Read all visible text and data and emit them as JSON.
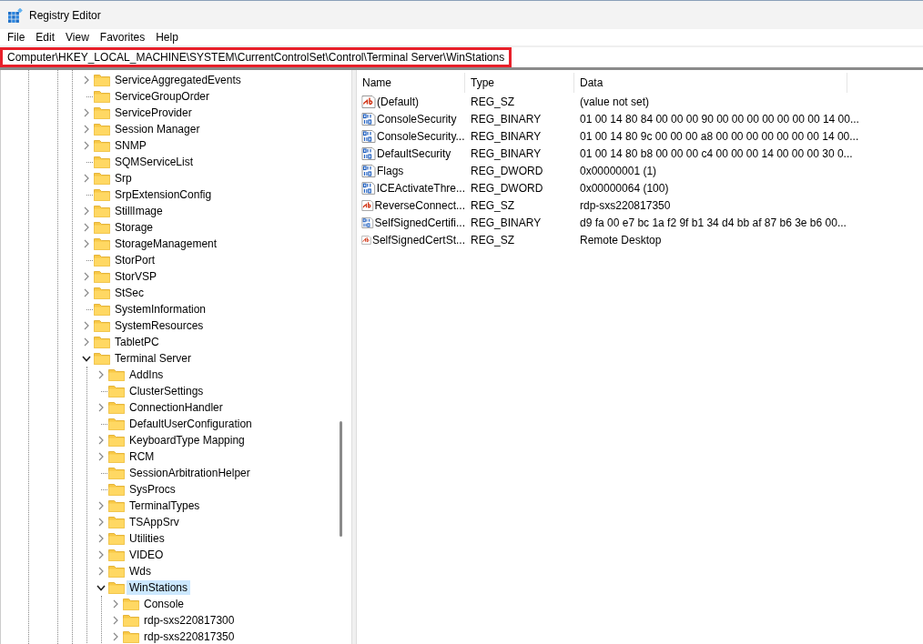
{
  "window": {
    "title": "Registry Editor"
  },
  "menu": [
    "File",
    "Edit",
    "View",
    "Favorites",
    "Help"
  ],
  "address": {
    "path": "Computer\\HKEY_LOCAL_MACHINE\\SYSTEM\\CurrentControlSet\\Control\\Terminal Server\\WinStations",
    "highlighted": true
  },
  "tree": [
    {
      "label": "ServiceAggregatedEvents",
      "expandable": true,
      "expanded": false,
      "selected": false
    },
    {
      "label": "ServiceGroupOrder",
      "expandable": false,
      "selected": false
    },
    {
      "label": "ServiceProvider",
      "expandable": true,
      "expanded": false,
      "selected": false
    },
    {
      "label": "Session Manager",
      "expandable": true,
      "expanded": false,
      "selected": false
    },
    {
      "label": "SNMP",
      "expandable": true,
      "expanded": false,
      "selected": false
    },
    {
      "label": "SQMServiceList",
      "expandable": false,
      "selected": false
    },
    {
      "label": "Srp",
      "expandable": true,
      "expanded": false,
      "selected": false
    },
    {
      "label": "SrpExtensionConfig",
      "expandable": false,
      "selected": false
    },
    {
      "label": "StillImage",
      "expandable": true,
      "expanded": false,
      "selected": false
    },
    {
      "label": "Storage",
      "expandable": true,
      "expanded": false,
      "selected": false
    },
    {
      "label": "StorageManagement",
      "expandable": true,
      "expanded": false,
      "selected": false
    },
    {
      "label": "StorPort",
      "expandable": false,
      "selected": false
    },
    {
      "label": "StorVSP",
      "expandable": true,
      "expanded": false,
      "selected": false
    },
    {
      "label": "StSec",
      "expandable": true,
      "expanded": false,
      "selected": false
    },
    {
      "label": "SystemInformation",
      "expandable": false,
      "selected": false
    },
    {
      "label": "SystemResources",
      "expandable": true,
      "expanded": false,
      "selected": false
    },
    {
      "label": "TabletPC",
      "expandable": true,
      "expanded": false,
      "selected": false
    },
    {
      "label": "Terminal Server",
      "expandable": true,
      "expanded": true,
      "selected": false,
      "children": [
        {
          "label": "AddIns",
          "expandable": true,
          "expanded": false,
          "selected": false
        },
        {
          "label": "ClusterSettings",
          "expandable": false,
          "selected": false
        },
        {
          "label": "ConnectionHandler",
          "expandable": true,
          "expanded": false,
          "selected": false
        },
        {
          "label": "DefaultUserConfiguration",
          "expandable": false,
          "selected": false
        },
        {
          "label": "KeyboardType Mapping",
          "expandable": true,
          "expanded": false,
          "selected": false
        },
        {
          "label": "RCM",
          "expandable": true,
          "expanded": false,
          "selected": false
        },
        {
          "label": "SessionArbitrationHelper",
          "expandable": false,
          "selected": false
        },
        {
          "label": "SysProcs",
          "expandable": false,
          "selected": false
        },
        {
          "label": "TerminalTypes",
          "expandable": true,
          "expanded": false,
          "selected": false
        },
        {
          "label": "TSAppSrv",
          "expandable": true,
          "expanded": false,
          "selected": false
        },
        {
          "label": "Utilities",
          "expandable": true,
          "expanded": false,
          "selected": false
        },
        {
          "label": "VIDEO",
          "expandable": true,
          "expanded": false,
          "selected": false
        },
        {
          "label": "Wds",
          "expandable": true,
          "expanded": false,
          "selected": false
        },
        {
          "label": "WinStations",
          "expandable": true,
          "expanded": true,
          "selected": true,
          "children": [
            {
              "label": "Console",
              "expandable": true,
              "expanded": false,
              "selected": false
            },
            {
              "label": "rdp-sxs220817300",
              "expandable": true,
              "expanded": false,
              "selected": false
            },
            {
              "label": "rdp-sxs220817350",
              "expandable": true,
              "expanded": false,
              "selected": false
            }
          ]
        }
      ]
    }
  ],
  "values": {
    "columns": [
      "Name",
      "Type",
      "Data"
    ],
    "rows": [
      {
        "kind": "string",
        "name": "(Default)",
        "type": "REG_SZ",
        "data": "(value not set)"
      },
      {
        "kind": "binary",
        "name": "ConsoleSecurity",
        "type": "REG_BINARY",
        "data": "01 00 14 80 84 00 00 00 90 00 00 00 00 00 00 00 14 00..."
      },
      {
        "kind": "binary",
        "name": "ConsoleSecurity...",
        "type": "REG_BINARY",
        "data": "01 00 14 80 9c 00 00 00 a8 00 00 00 00 00 00 00 14 00..."
      },
      {
        "kind": "binary",
        "name": "DefaultSecurity",
        "type": "REG_BINARY",
        "data": "01 00 14 80 b8 00 00 00 c4 00 00 00 14 00 00 00 30 0..."
      },
      {
        "kind": "binary",
        "name": "Flags",
        "type": "REG_DWORD",
        "data": "0x00000001 (1)"
      },
      {
        "kind": "binary",
        "name": "ICEActivateThre...",
        "type": "REG_DWORD",
        "data": "0x00000064 (100)"
      },
      {
        "kind": "string",
        "name": "ReverseConnect...",
        "type": "REG_SZ",
        "data": "rdp-sxs220817350"
      },
      {
        "kind": "binary",
        "name": "SelfSignedCertifi...",
        "type": "REG_BINARY",
        "data": "d9 fa 00 e7 bc 1a f2 9f b1 34 d4 bb af 87 b6 3e b6 00..."
      },
      {
        "kind": "string",
        "name": "SelfSignedCertSt...",
        "type": "REG_SZ",
        "data": "Remote Desktop"
      }
    ]
  }
}
